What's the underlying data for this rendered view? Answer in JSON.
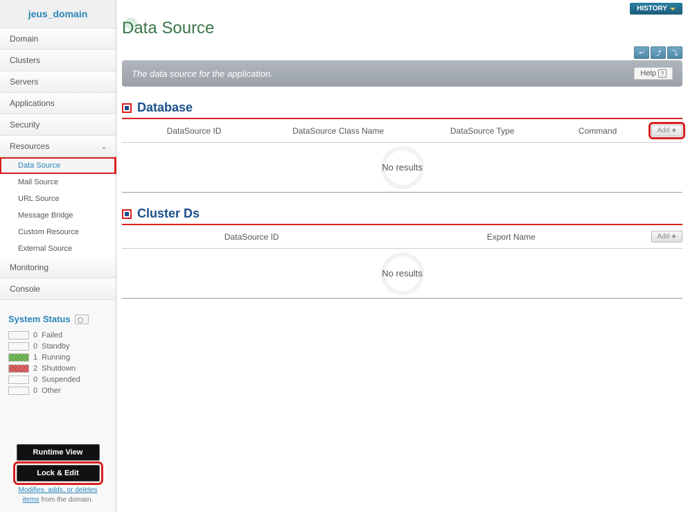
{
  "sidebar": {
    "domain": "jeus_domain",
    "items": [
      {
        "label": "Domain"
      },
      {
        "label": "Clusters"
      },
      {
        "label": "Servers"
      },
      {
        "label": "Applications"
      },
      {
        "label": "Security"
      },
      {
        "label": "Resources",
        "expanded": true,
        "children": [
          {
            "label": "Data Source",
            "active": true,
            "hl": true
          },
          {
            "label": "Mail Source"
          },
          {
            "label": "URL Source"
          },
          {
            "label": "Message Bridge"
          },
          {
            "label": "Custom Resource"
          },
          {
            "label": "External Source"
          }
        ]
      },
      {
        "label": "Monitoring"
      },
      {
        "label": "Console"
      }
    ]
  },
  "status": {
    "title": "System Status",
    "rows": [
      {
        "count": 0,
        "label": "Failed",
        "swatch": ""
      },
      {
        "count": 0,
        "label": "Standby",
        "swatch": ""
      },
      {
        "count": 1,
        "label": "Running",
        "swatch": "swatch-running"
      },
      {
        "count": 2,
        "label": "Shutdown",
        "swatch": "swatch-shutdown"
      },
      {
        "count": 0,
        "label": "Suspended",
        "swatch": ""
      },
      {
        "count": 0,
        "label": "Other",
        "swatch": ""
      }
    ]
  },
  "buttons": {
    "runtime": "Runtime View",
    "lock": "Lock & Edit",
    "desc_link": "Modifies, adds, or deletes items",
    "desc_rest": " from the domain."
  },
  "topbar": {
    "history": "HISTORY"
  },
  "page": {
    "title": "Data Source",
    "desc": "The data source for the application.",
    "help": "Help"
  },
  "sections": {
    "database": {
      "title": "Database",
      "cols": [
        "DataSource ID",
        "DataSource Class Name",
        "DataSource Type",
        "Command"
      ],
      "add": "Add",
      "empty": "No results"
    },
    "cluster": {
      "title": "Cluster Ds",
      "cols": [
        "DataSource ID",
        "Export Name"
      ],
      "add": "Add",
      "empty": "No results"
    }
  }
}
